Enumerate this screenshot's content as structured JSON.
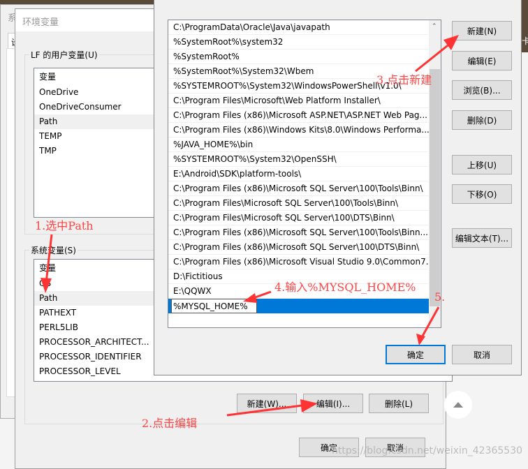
{
  "back_window": {
    "title_fragment": "系",
    "tab_fragment": "设",
    "right_fragment": "卡"
  },
  "env_window": {
    "title": "环境变量",
    "user_group_label": "LF 的用户变量(U)",
    "user_list_header": "变量",
    "user_vars": [
      "OneDrive",
      "OneDriveConsumer",
      "Path",
      "TEMP",
      "TMP"
    ],
    "user_selected": "Path",
    "system_group_label": "系统变量(S)",
    "system_list_header": "变量",
    "system_vars": [
      "OS",
      "Path",
      "PATHEXT",
      "PERL5LIB",
      "PROCESSOR_ARCHITECT...",
      "PROCESSOR_IDENTIFIER",
      "PROCESSOR_LEVEL"
    ],
    "system_selected": "Path",
    "buttons": {
      "new": "新建(W)...",
      "edit": "编辑(I)...",
      "delete": "删除(L)",
      "ok": "确定",
      "cancel": "取消"
    }
  },
  "edit_dialog": {
    "paths": [
      "C:\\ProgramData\\Oracle\\Java\\javapath",
      "%SystemRoot%\\system32",
      "%SystemRoot%",
      "%SystemRoot%\\System32\\Wbem",
      "%SYSTEMROOT%\\System32\\WindowsPowerShell\\v1.0\\",
      "C:\\Program Files\\Microsoft\\Web Platform Installer\\",
      "C:\\Program Files (x86)\\Microsoft ASP.NET\\ASP.NET Web Pag...",
      "C:\\Program Files (x86)\\Windows Kits\\8.0\\Windows Performa...",
      "%JAVA_HOME%\\bin",
      "%SYSTEMROOT%\\System32\\OpenSSH\\",
      "E:\\Android\\SDK\\platform-tools\\",
      "C:\\Program Files (x86)\\Microsoft SQL Server\\100\\Tools\\Binn\\",
      "C:\\Program Files\\Microsoft SQL Server\\100\\Tools\\Binn\\",
      "C:\\Program Files\\Microsoft SQL Server\\100\\DTS\\Binn\\",
      "C:\\Program Files (x86)\\Microsoft SQL Server\\100\\Tools\\Binn...",
      "C:\\Program Files (x86)\\Microsoft SQL Server\\100\\DTS\\Binn\\",
      "C:\\Program Files (x86)\\Microsoft Visual Studio 9.0\\Common7...",
      "D:\\Fictitious",
      "E:\\QQWX"
    ],
    "editing_value": "%MYSQL_HOME%",
    "buttons": {
      "new": "新建(N)",
      "edit": "编辑(E)",
      "browse": "浏览(B)...",
      "delete": "删除(D)",
      "move_up": "上移(U)",
      "move_down": "下移(O)",
      "edit_text": "编辑文本(T)...",
      "ok": "确定",
      "cancel": "取消"
    },
    "selection_color": "#0078d7"
  },
  "annotations": {
    "step1": "1.选中Path",
    "step2": "2.点击编辑",
    "step3": "3.点击新建",
    "step4": "4.输入%MYSQL_HOME%",
    "step5": "5.",
    "color": "#ff4444"
  },
  "watermark": "https://blog.csdn.net/weixin_42365530"
}
